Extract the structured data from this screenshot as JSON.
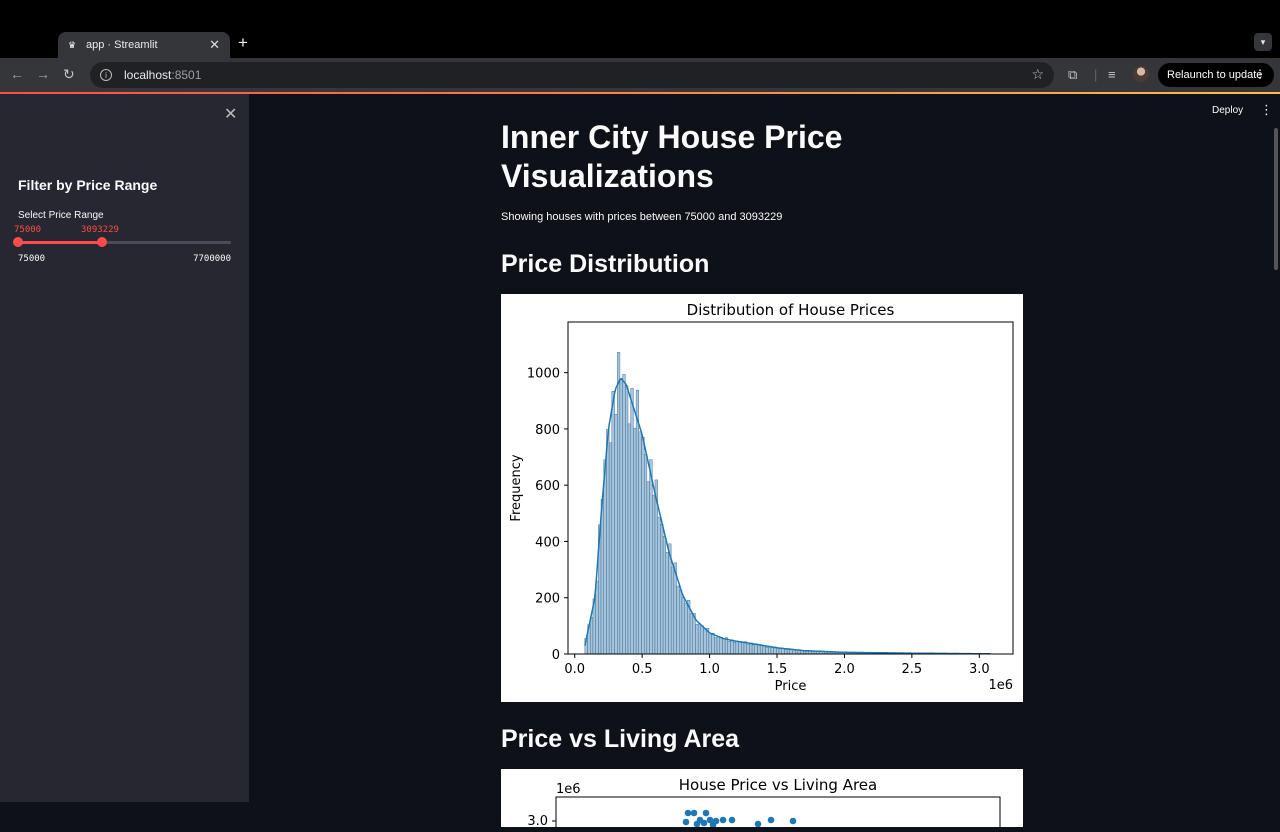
{
  "browser": {
    "tab_title": "app · Streamlit",
    "url_host": "localhost",
    "url_port": ":8501",
    "relaunch_label": "Relaunch to update"
  },
  "sidebar": {
    "title": "Filter by Price Range",
    "slider_label": "Select Price Range",
    "value_low": "75000",
    "value_high": "3093229",
    "min_label": "75000",
    "max_label": "7700000",
    "slider_min": 75000,
    "slider_max": 7700000,
    "accent": "#ff4b4b"
  },
  "header": {
    "deploy_label": "Deploy"
  },
  "main": {
    "title": "Inner City House Price Visualizations",
    "caption": "Showing houses with prices between 75000 and 3093229",
    "section1": "Price Distribution",
    "section2": "Price vs Living Area"
  },
  "chart_data": [
    {
      "type": "bar",
      "title": "Distribution of House Prices",
      "xlabel": "Price",
      "ylabel": "Frequency",
      "x_offset_label": "1e6",
      "xlim": [
        -0.05,
        3.25
      ],
      "ylim": [
        0,
        1180
      ],
      "xticks": [
        0.0,
        0.5,
        1.0,
        1.5,
        2.0,
        2.5,
        3.0
      ],
      "yticks": [
        0,
        200,
        400,
        600,
        800,
        1000
      ],
      "bar_color": "#a6c5dc",
      "line_color": "#1f77b4",
      "kde": [
        [
          0.075,
          30
        ],
        [
          0.15,
          200
        ],
        [
          0.2,
          520
        ],
        [
          0.25,
          800
        ],
        [
          0.3,
          940
        ],
        [
          0.34,
          980
        ],
        [
          0.38,
          960
        ],
        [
          0.42,
          900
        ],
        [
          0.5,
          780
        ],
        [
          0.6,
          560
        ],
        [
          0.7,
          360
        ],
        [
          0.8,
          210
        ],
        [
          0.9,
          120
        ],
        [
          1.0,
          75
        ],
        [
          1.1,
          55
        ],
        [
          1.2,
          45
        ],
        [
          1.3,
          38
        ],
        [
          1.4,
          30
        ],
        [
          1.5,
          22
        ],
        [
          1.7,
          12
        ],
        [
          2.0,
          6
        ],
        [
          2.5,
          3
        ],
        [
          3.0,
          1
        ]
      ]
    },
    {
      "type": "scatter",
      "title": "House Price vs Living Area",
      "y_offset_label": "1e6",
      "ytick_top": "3.0",
      "point_color": "#1f77b4"
    }
  ]
}
